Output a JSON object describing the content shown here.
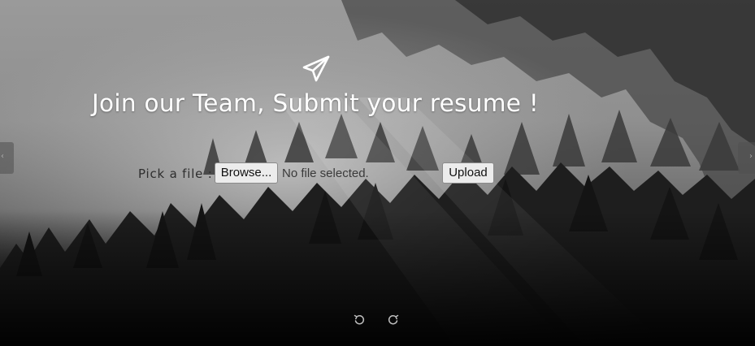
{
  "page": {
    "title": "Join our Team, Submit your resume !"
  },
  "upload_form": {
    "label": "Pick a file :",
    "browse_label": "Browse...",
    "file_status": "No file selected.",
    "upload_label": "Upload"
  },
  "icons": {
    "header": "paper-plane-icon",
    "carousel_prev": "chevron-left-icon",
    "carousel_next": "chevron-right-icon",
    "undo": "rotate-ccw-icon",
    "redo": "rotate-cw-icon"
  },
  "colors": {
    "title_text": "#ffffff",
    "label_text": "#2e2e2e",
    "button_bg": "#ececec",
    "fog_light": "#bdbdbd",
    "forest_dark": "#0a0a0a"
  }
}
